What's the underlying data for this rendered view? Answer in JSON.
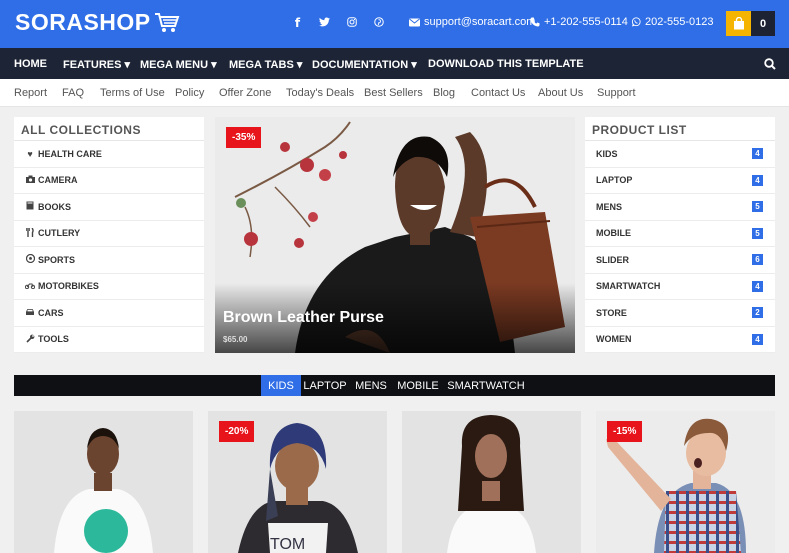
{
  "header": {
    "logo_text": "SORASHOP",
    "social_icons": [
      "facebook-icon",
      "twitter-icon",
      "instagram-icon",
      "pinterest-icon"
    ],
    "email": "support@soracart.com",
    "phone": "+1-202-555-0114",
    "whatsapp": "202-555-0123",
    "cart_count": "0",
    "colors": {
      "primary": "#2f6ee6",
      "nav": "#1d2435",
      "cart": "#f5b400",
      "sale": "#e8141b"
    }
  },
  "nav": {
    "items": [
      {
        "label": "HOME",
        "dropdown": false
      },
      {
        "label": "FEATURES",
        "dropdown": true
      },
      {
        "label": "MEGA MENU",
        "dropdown": true
      },
      {
        "label": "MEGA TABS",
        "dropdown": true
      },
      {
        "label": "DOCUMENTATION",
        "dropdown": true
      },
      {
        "label": "DOWNLOAD THIS TEMPLATE",
        "dropdown": false
      }
    ]
  },
  "subnav": {
    "links": [
      "Report",
      "FAQ",
      "Terms of Use",
      "Policy",
      "Offer Zone",
      "Today's Deals",
      "Best Sellers",
      "Blog",
      "Contact Us",
      "About Us",
      "Support"
    ]
  },
  "collections": {
    "title": "ALL COLLECTIONS",
    "items": [
      {
        "label": "HEALTH CARE",
        "icon": "heartbeat-icon"
      },
      {
        "label": "CAMERA",
        "icon": "camera-icon"
      },
      {
        "label": "BOOKS",
        "icon": "book-icon"
      },
      {
        "label": "CUTLERY",
        "icon": "cutlery-icon"
      },
      {
        "label": "SPORTS",
        "icon": "soccer-ball-icon"
      },
      {
        "label": "MOTORBIKES",
        "icon": "motorbike-icon"
      },
      {
        "label": "CARS",
        "icon": "car-icon"
      },
      {
        "label": "TOOLS",
        "icon": "wrench-icon"
      }
    ]
  },
  "hero": {
    "badge": "-35%",
    "title": "Brown Leather Purse",
    "price": "$65.00"
  },
  "product_list": {
    "title": "PRODUCT LIST",
    "items": [
      {
        "label": "KIDS",
        "count": "4"
      },
      {
        "label": "LAPTOP",
        "count": "4"
      },
      {
        "label": "MENS",
        "count": "5"
      },
      {
        "label": "MOBILE",
        "count": "5"
      },
      {
        "label": "SLIDER",
        "count": "6"
      },
      {
        "label": "SMARTWATCH",
        "count": "4"
      },
      {
        "label": "STORE",
        "count": "2"
      },
      {
        "label": "WOMEN",
        "count": "4"
      }
    ]
  },
  "tabs": {
    "items": [
      "KIDS",
      "LAPTOP",
      "MENS",
      "MOBILE",
      "SMARTWATCH"
    ],
    "active": "KIDS"
  },
  "cards": [
    {
      "badge": ""
    },
    {
      "badge": "-20%"
    },
    {
      "badge": ""
    },
    {
      "badge": "-15%"
    }
  ]
}
